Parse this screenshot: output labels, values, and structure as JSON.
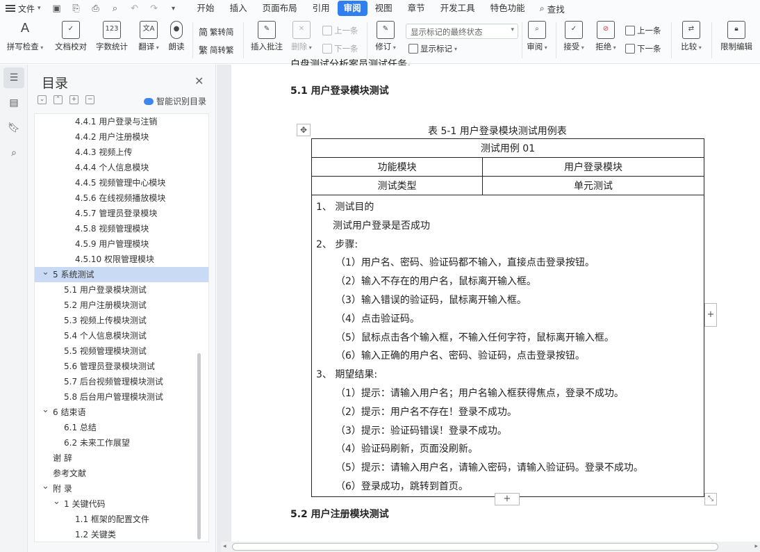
{
  "menu": {
    "file_label": "文件",
    "tabs": [
      "开始",
      "插入",
      "页面布局",
      "引用",
      "审阅",
      "视图",
      "章节",
      "开发工具",
      "特色功能"
    ],
    "active_tab": "审阅",
    "search_label": "查找"
  },
  "ribbon": {
    "spell_check": "拼写检查",
    "doc_proof": "文档校对",
    "word_count": "字数统计",
    "translate": "翻译",
    "read_aloud": "朗读",
    "trad_to_simp": "繁转简",
    "simp_to_trad": "简转繁",
    "insert_comment": "插入批注",
    "delete": "删除",
    "prev_comment": "上一条",
    "next_comment": "下一条",
    "revise": "修订",
    "display_select": "显示标记的最终状态",
    "show_markup": "显示标记",
    "review": "审阅",
    "accept": "接受",
    "reject": "拒绝",
    "prev_change": "上一条",
    "next_change": "下一条",
    "compare": "比较",
    "restrict_edit": "限制编辑"
  },
  "toc": {
    "title": "目录",
    "smart_label": "智能识别目录",
    "items": [
      {
        "text": "4.4.1 用户登录与注销",
        "level": 3
      },
      {
        "text": "4.4.2 用户注册模块",
        "level": 3
      },
      {
        "text": "4.4.3 视频上传",
        "level": 3
      },
      {
        "text": "4.4.4 个人信息模块",
        "level": 3
      },
      {
        "text": "4.4.5 视频管理中心模块",
        "level": 3
      },
      {
        "text": "4.5.6 在线视频播放模块",
        "level": 3
      },
      {
        "text": "4.5.7 管理员登录模块",
        "level": 3
      },
      {
        "text": "4.5.8 视频管理模块",
        "level": 3
      },
      {
        "text": "4.5.9 用户管理模块",
        "level": 3
      },
      {
        "text": "4.5.10  权限管理模块",
        "level": 3
      },
      {
        "text": "5   系统测试",
        "level": 1,
        "expanded": true,
        "selected": true
      },
      {
        "text": "5.1  用户登录模块测试",
        "level": 2
      },
      {
        "text": "5.2  用户注册模块测试",
        "level": 2
      },
      {
        "text": "5.3  视频上传模块测试",
        "level": 2
      },
      {
        "text": "5.4  个人信息模块测试",
        "level": 2
      },
      {
        "text": "5.5  视频管理模块测试",
        "level": 2
      },
      {
        "text": "5.6  管理员登录模块测试",
        "level": 2
      },
      {
        "text": "5.7  后台视频管理模块测试",
        "level": 2
      },
      {
        "text": "5.8  后台用户管理模块测试",
        "level": 2
      },
      {
        "text": "6   结束语",
        "level": 1,
        "expanded": true
      },
      {
        "text": "6.1  总结",
        "level": 2
      },
      {
        "text": "6.2  未来工作展望",
        "level": 2
      },
      {
        "text": "谢  辞",
        "level": 1
      },
      {
        "text": "参考文献",
        "level": 1
      },
      {
        "text": "附  录",
        "level": 1,
        "expanded": true
      },
      {
        "text": "1 关键代码",
        "level": 2,
        "expanded": true
      },
      {
        "text": "1.1 框架的配置文件",
        "level": 3
      },
      {
        "text": "1.2  关键类",
        "level": 3
      }
    ]
  },
  "document": {
    "cut_line": "白盘测试分析案员测试任务。",
    "heading_51": "5.1  用户登录模块测试",
    "table_caption": "表 5-1 用户登录模块测试用例表",
    "case_title": "测试用例 01",
    "row1": [
      "功能模块",
      "用户登录模块"
    ],
    "row2": [
      "测试类型",
      "单元测试"
    ],
    "body_lines": [
      {
        "text": "1、 测试目的",
        "indent": 0
      },
      {
        "text": "测试用户登录是否成功",
        "indent": 1
      },
      {
        "text": "2、 步骤:",
        "indent": 0
      },
      {
        "text": "（1）用户名、密码、验证码都不输入，直接点击登录按钮。",
        "indent": 2
      },
      {
        "text": "（2）输入不存在的用户名，鼠标离开输入框。",
        "indent": 2
      },
      {
        "text": "（3）输入错误的验证码，鼠标离开输入框。",
        "indent": 2
      },
      {
        "text": "（4）点击验证码。",
        "indent": 2
      },
      {
        "text": "（5）鼠标点击各个输入框，不输入任何字符，鼠标离开输入框。",
        "indent": 2
      },
      {
        "text": "（6）输入正确的用户名、密码、验证码，点击登录按钮。",
        "indent": 2
      },
      {
        "text": "3、 期望结果:",
        "indent": 0
      },
      {
        "text": "（1）提示：请输入用户名；用户名输入框获得焦点，登录不成功。",
        "indent": 2
      },
      {
        "text": "（2）提示：用户名不存在！登录不成功。",
        "indent": 2
      },
      {
        "text": "（3）提示：验证码错误！登录不成功。",
        "indent": 2
      },
      {
        "text": "（4）验证码刷新，页面没刷新。",
        "indent": 2
      },
      {
        "text": "（5）提示：请输入用户名，请输入密码，请输入验证码。登录不成功。",
        "indent": 2
      },
      {
        "text": "（6）登录成功，跳转到首页。",
        "indent": 2
      }
    ],
    "heading_52": "5.2  用户注册模块测试"
  }
}
